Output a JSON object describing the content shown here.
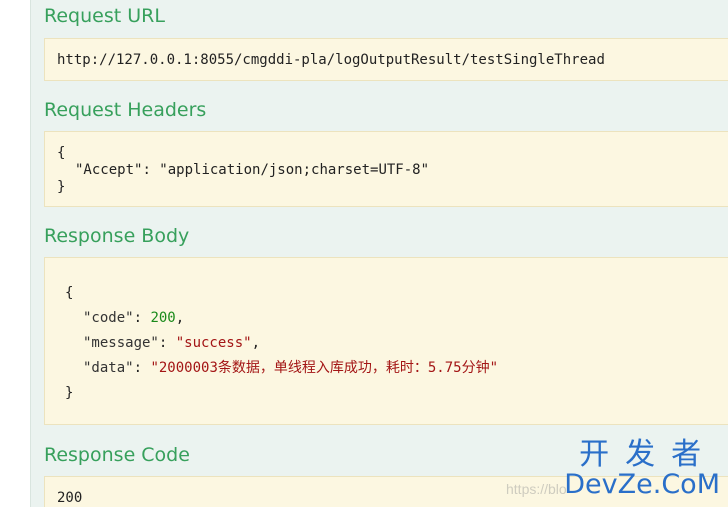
{
  "sections": {
    "request_url": {
      "heading": "Request URL",
      "value": "http://127.0.0.1:8055/cmgddi-pla/logOutputResult/testSingleThread"
    },
    "request_headers": {
      "heading": "Request Headers",
      "open_brace": "{",
      "key": "\"Accept\"",
      "sep": ": ",
      "value": "\"application/json;charset=UTF-8\"",
      "close_brace": "}"
    },
    "response_body": {
      "heading": "Response Body",
      "open_brace": "{",
      "code_key": "\"code\"",
      "code_value": "200",
      "message_key": "\"message\"",
      "message_value": "\"success\"",
      "data_key": "\"data\"",
      "data_value": "\"2000003条数据，单线程入库成功，耗时：5.75分钟\"",
      "close_brace": "}",
      "colon": ": ",
      "comma": ","
    },
    "response_code": {
      "heading": "Response Code",
      "value": "200"
    }
  },
  "watermark": {
    "chinese": "开发者",
    "english": "DevZe.CoM",
    "url": "https://blo"
  },
  "colors": {
    "heading": "#37a05c",
    "panel_bg": "#ebf3f0",
    "code_bg": "#fcf7e1",
    "number": "#1a8a1a",
    "string": "#a31515",
    "watermark": "#2a6fc9"
  }
}
